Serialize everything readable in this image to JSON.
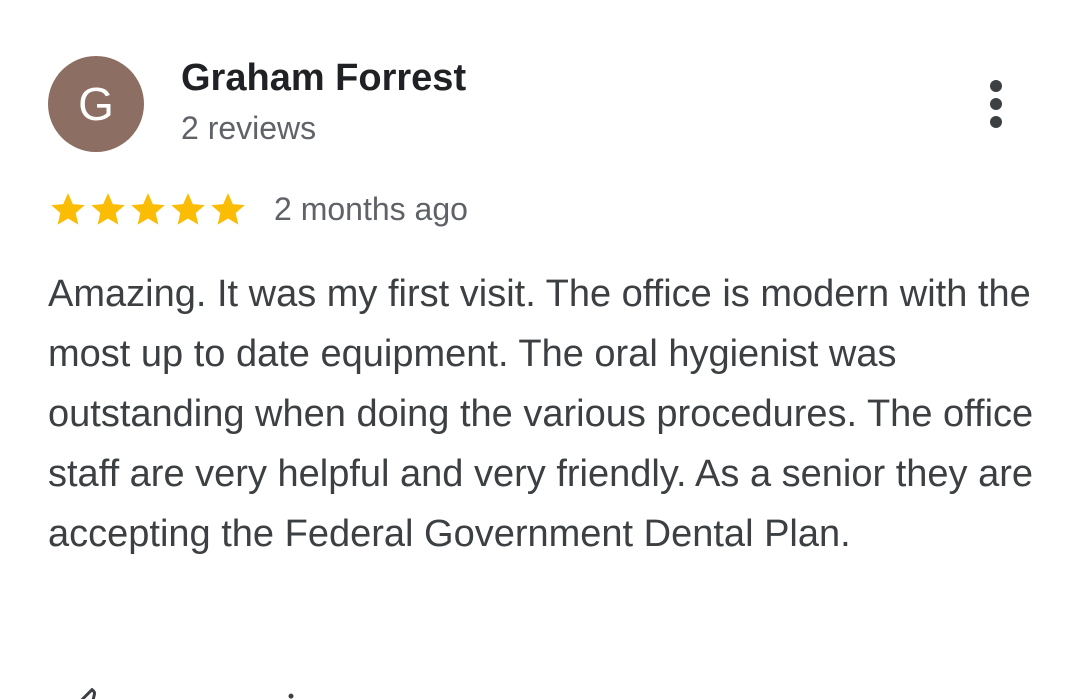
{
  "reviewer": {
    "initial": "G",
    "name": "Graham Forrest",
    "review_count": "2 reviews",
    "avatar_color": "#8d6e63"
  },
  "menu": {
    "icon": "more-vert-icon"
  },
  "review": {
    "rating": 5,
    "rating_max": 5,
    "star_color": "#fbbc04",
    "date": "2 months ago",
    "text": "Amazing. It was my first visit. The office is modern with the most up to date equipment. The oral hygienist was outstanding when doing the various procedures. The office staff are very helpful and very friendly. As a senior they are accepting the Federal Government Dental Plan."
  },
  "actions": {
    "like_icon": "thumb-up-icon",
    "share_icon": "share-icon"
  }
}
